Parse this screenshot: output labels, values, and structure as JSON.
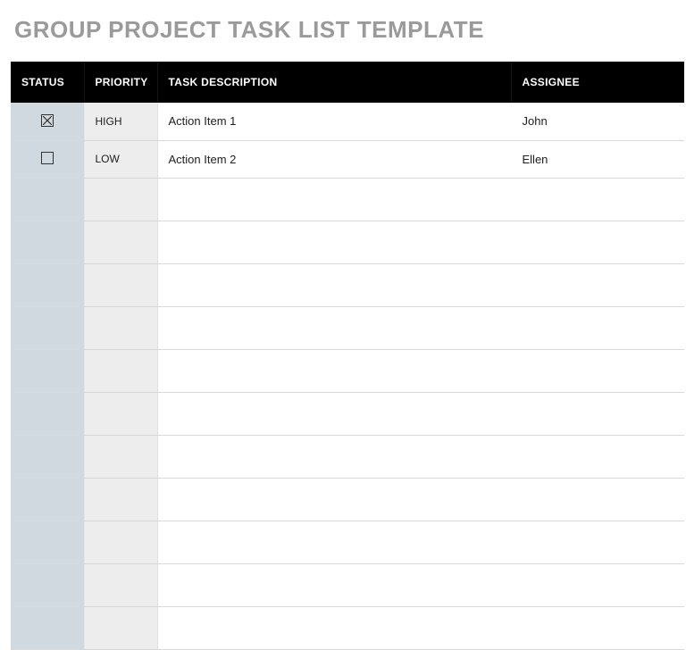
{
  "title": "GROUP PROJECT TASK LIST TEMPLATE",
  "columns": {
    "status": "STATUS",
    "priority": "PRIORITY",
    "description": "TASK DESCRIPTION",
    "assignee": "ASSIGNEE"
  },
  "rows": [
    {
      "status_checked": true,
      "priority": "HIGH",
      "description": "Action Item 1",
      "assignee": "John"
    },
    {
      "status_checked": false,
      "priority": "LOW",
      "description": "Action Item 2",
      "assignee": "Ellen"
    },
    {
      "status_checked": null,
      "priority": "",
      "description": "",
      "assignee": ""
    },
    {
      "status_checked": null,
      "priority": "",
      "description": "",
      "assignee": ""
    },
    {
      "status_checked": null,
      "priority": "",
      "description": "",
      "assignee": ""
    },
    {
      "status_checked": null,
      "priority": "",
      "description": "",
      "assignee": ""
    },
    {
      "status_checked": null,
      "priority": "",
      "description": "",
      "assignee": ""
    },
    {
      "status_checked": null,
      "priority": "",
      "description": "",
      "assignee": ""
    },
    {
      "status_checked": null,
      "priority": "",
      "description": "",
      "assignee": ""
    },
    {
      "status_checked": null,
      "priority": "",
      "description": "",
      "assignee": ""
    },
    {
      "status_checked": null,
      "priority": "",
      "description": "",
      "assignee": ""
    },
    {
      "status_checked": null,
      "priority": "",
      "description": "",
      "assignee": ""
    },
    {
      "status_checked": null,
      "priority": "",
      "description": "",
      "assignee": ""
    }
  ]
}
